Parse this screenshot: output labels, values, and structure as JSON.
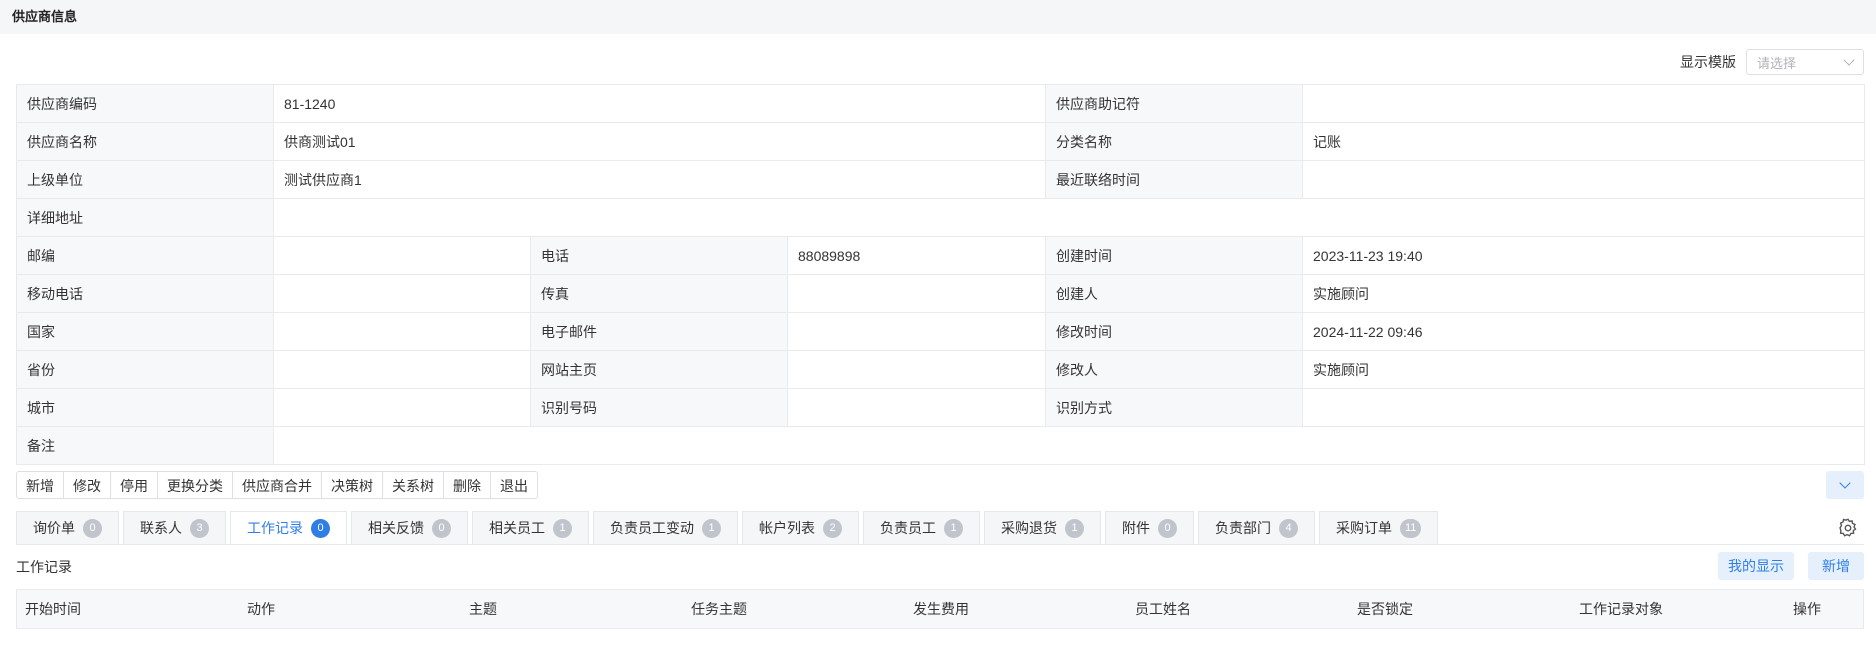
{
  "page_title": "供应商信息",
  "template": {
    "label": "显示模版",
    "placeholder": "请选择"
  },
  "info_rows": [
    {
      "type": "two",
      "cells": [
        [
          "供应商编码",
          "81-1240"
        ],
        [
          "供应商助记符",
          ""
        ]
      ]
    },
    {
      "type": "two",
      "cells": [
        [
          "供应商名称",
          "供商测试01"
        ],
        [
          "分类名称",
          "记账"
        ]
      ]
    },
    {
      "type": "two",
      "cells": [
        [
          "上级单位",
          "测试供应商1"
        ],
        [
          "最近联络时间",
          ""
        ]
      ]
    },
    {
      "type": "one",
      "cells": [
        [
          "详细地址",
          ""
        ]
      ]
    },
    {
      "type": "three",
      "cells": [
        [
          "邮编",
          ""
        ],
        [
          "电话",
          "88089898"
        ],
        [
          "创建时间",
          "2023-11-23 19:40"
        ]
      ]
    },
    {
      "type": "three",
      "cells": [
        [
          "移动电话",
          ""
        ],
        [
          "传真",
          ""
        ],
        [
          "创建人",
          "实施顾问"
        ]
      ]
    },
    {
      "type": "three",
      "cells": [
        [
          "国家",
          ""
        ],
        [
          "电子邮件",
          ""
        ],
        [
          "修改时间",
          "2024-11-22 09:46"
        ]
      ]
    },
    {
      "type": "three",
      "cells": [
        [
          "省份",
          ""
        ],
        [
          "网站主页",
          ""
        ],
        [
          "修改人",
          "实施顾问"
        ]
      ]
    },
    {
      "type": "three",
      "cells": [
        [
          "城市",
          ""
        ],
        [
          "识别号码",
          ""
        ],
        [
          "识别方式",
          ""
        ]
      ]
    },
    {
      "type": "one",
      "cells": [
        [
          "备注",
          ""
        ]
      ]
    }
  ],
  "toolbar": [
    "新增",
    "修改",
    "停用",
    "更换分类",
    "供应商合并",
    "决策树",
    "关系树",
    "删除",
    "退出"
  ],
  "tabs": [
    {
      "label": "询价单",
      "count": "0"
    },
    {
      "label": "联系人",
      "count": "3"
    },
    {
      "label": "工作记录",
      "count": "0",
      "active": true
    },
    {
      "label": "相关反馈",
      "count": "0"
    },
    {
      "label": "相关员工",
      "count": "1"
    },
    {
      "label": "负责员工变动",
      "count": "1"
    },
    {
      "label": "帐户列表",
      "count": "2"
    },
    {
      "label": "负责员工",
      "count": "1"
    },
    {
      "label": "采购退货",
      "count": "1"
    },
    {
      "label": "附件",
      "count": "0"
    },
    {
      "label": "负责部门",
      "count": "4"
    },
    {
      "label": "采购订单",
      "count": "11"
    }
  ],
  "section": {
    "title": "工作记录",
    "my_display": "我的显示",
    "add": "新增"
  },
  "grid_columns": [
    "开始时间",
    "动作",
    "主题",
    "任务主题",
    "发生费用",
    "员工姓名",
    "是否锁定",
    "工作记录对象",
    "操作"
  ],
  "icons": {
    "settings": "gear-icon",
    "collapse": "chevron-down-icon",
    "select": "chevron-down-icon"
  },
  "colors": {
    "accent": "#2f7ee6",
    "accent_light": "#e6f0fc",
    "label_bg": "#f7f8fa",
    "badge_gray": "#c0c4cc"
  }
}
